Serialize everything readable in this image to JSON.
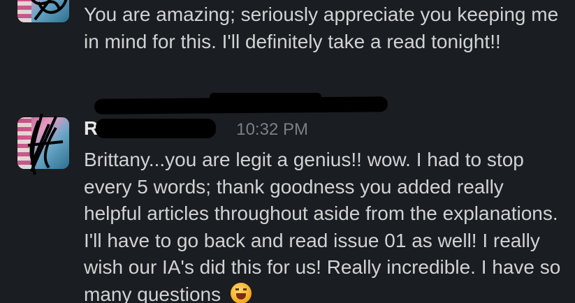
{
  "messages": [
    {
      "sender": "",
      "time": "",
      "text": "You are amazing; seriously appreciate you keeping me in mind for this. I'll definitely take a read tonight!!"
    },
    {
      "sender": "R",
      "time": "10:32 PM",
      "text": "Brittany...you are legit a genius!! wow. I had to stop every 5 words; thank goodness you added really helpful articles throughout aside from the explanations. I'll have to go back and read issue 01 as well! I really wish our IA's did this for us! Really incredible. I have so many questions",
      "emoji": "grimacing-face-emoji"
    }
  ]
}
